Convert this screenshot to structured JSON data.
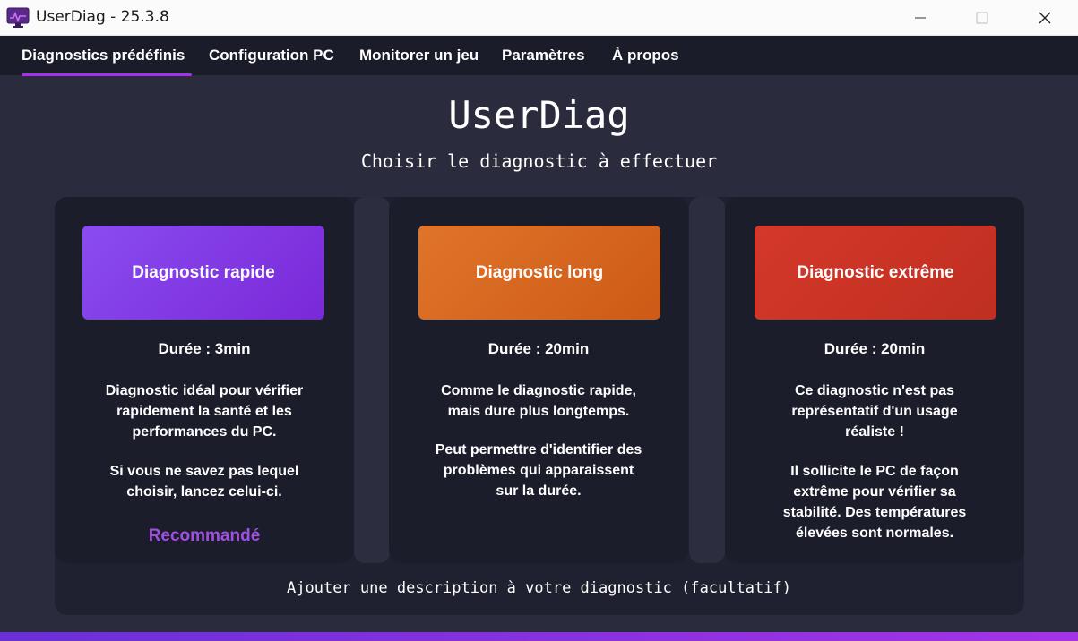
{
  "window": {
    "title": "UserDiag - 25.3.8"
  },
  "nav": {
    "tabs": [
      {
        "label": "Diagnostics prédéfinis"
      },
      {
        "label": "Configuration PC"
      },
      {
        "label": "Monitorer un jeu"
      },
      {
        "label": "Paramètres"
      },
      {
        "label": "À propos"
      }
    ],
    "active_index": 0
  },
  "header": {
    "title": "UserDiag",
    "subtitle": "Choisir le diagnostic à effectuer"
  },
  "cards": [
    {
      "button": "Diagnostic rapide",
      "duration": "Durée : 3min",
      "desc1": [
        "Diagnostic idéal pour vérifier",
        "rapidement la santé et les",
        "performances du PC."
      ],
      "desc2": [
        "Si vous ne savez pas lequel",
        "choisir, lancez celui-ci."
      ],
      "badge": "Recommandé"
    },
    {
      "button": "Diagnostic long",
      "duration": "Durée : 20min",
      "desc1": [
        "Comme le diagnostic rapide,",
        "mais dure plus longtemps."
      ],
      "desc2": [
        "Peut permettre d'identifier des",
        "problèmes qui apparaissent",
        "sur la durée."
      ]
    },
    {
      "button": "Diagnostic extrême",
      "duration": "Durée : 20min",
      "desc1": [
        "Ce diagnostic n'est pas",
        "représentatif d'un usage",
        "réaliste !"
      ],
      "desc2": [
        "Il sollicite le PC de façon",
        "extrême pour vérifier sa",
        "stabilité. Des températures",
        "élevées sont normales."
      ]
    }
  ],
  "footer": {
    "description_link": "Ajouter une description à votre diagnostic (facultatif)"
  },
  "colors": {
    "accent": "#a233e8",
    "rapide": "#8a4cf0",
    "long": "#e0742a",
    "extreme": "#d4382a",
    "recommended": "#a050e0"
  }
}
